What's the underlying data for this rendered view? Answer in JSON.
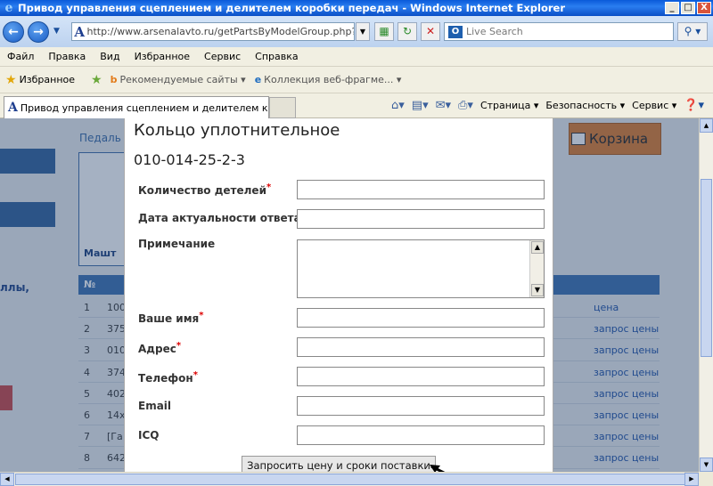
{
  "window": {
    "title": "Привод управления сцеплением и делителем коробки передач - Windows Internet Explorer",
    "minimize": "_",
    "maximize": "□",
    "close": "X"
  },
  "addressbar": {
    "url": "http://www.arsenalavto.ru/getPartsByModelGroup.php?type",
    "search_placeholder": "Live Search"
  },
  "menu": [
    "Файл",
    "Правка",
    "Вид",
    "Избранное",
    "Сервис",
    "Справка"
  ],
  "favorites": {
    "label": "Избранное",
    "items": [
      "Рекомендуемые сайты ▾",
      "Коллекция веб-фрагме... ▾"
    ]
  },
  "tab": {
    "title": "Привод управления сцеплением и делителем коро..."
  },
  "tools": {
    "page": "Страница ▾",
    "security": "Безопасность ▾",
    "service": "Сервис ▾"
  },
  "page": {
    "breadcrumb": "Педаль",
    "cart": "Корзина",
    "side_text": "ллы,",
    "masht": "Машт",
    "table": {
      "no_header": "№",
      "rows": [
        {
          "num": "1",
          "code": "100",
          "price": "цена"
        },
        {
          "num": "2",
          "code": "375",
          "price": "запрос цены"
        },
        {
          "num": "3",
          "code": "010",
          "price": "запрос цены"
        },
        {
          "num": "4",
          "code": "374",
          "price": "запрос цены"
        },
        {
          "num": "5",
          "code": "402",
          "price": "запрос цены"
        },
        {
          "num": "6",
          "code": "14x",
          "price": "запрос цены"
        },
        {
          "num": "7",
          "code": "[Га",
          "price": "запрос цены"
        },
        {
          "num": "8",
          "code": "642",
          "price": "запрос цены"
        }
      ]
    }
  },
  "modal": {
    "title": "Кольцо уплотнительное",
    "code": "010-014-25-2-3",
    "fields": {
      "quantity": "Количество детелей",
      "date": "Дата актуальности ответа",
      "note": "Примечание",
      "name": "Ваше имя",
      "address": "Адрес",
      "phone": "Телефон",
      "email": "Email",
      "icq": "ICQ"
    },
    "required_mark": "*",
    "submit": "Запросить цену и сроки поставки"
  }
}
